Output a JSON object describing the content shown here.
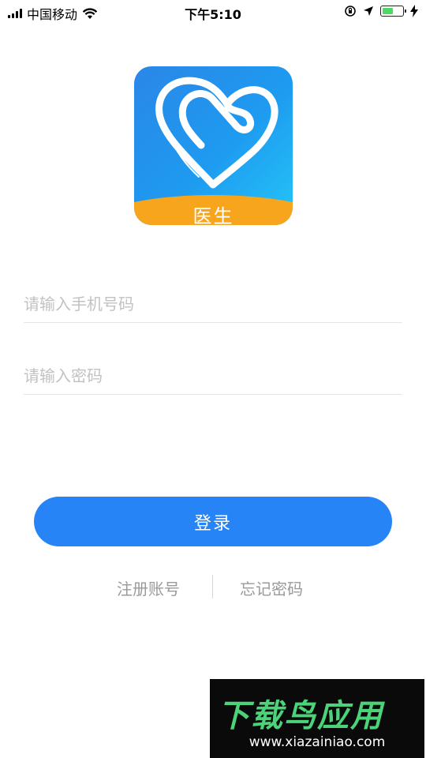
{
  "status_bar": {
    "carrier": "中国移动",
    "time": "下午5:10",
    "battery_level": 0.55,
    "battery_color": "#4cd964"
  },
  "logo": {
    "label": "医生",
    "gradient_colors": [
      "#2a86e8",
      "#24c6f7"
    ],
    "band_color": "#f7a51c",
    "icon": "heart-line-icon"
  },
  "form": {
    "phone_placeholder": "请输入手机号码",
    "phone_value": "",
    "password_placeholder": "请输入密码",
    "password_value": ""
  },
  "login_button": {
    "label": "登录",
    "color": "#2684f6"
  },
  "links": {
    "register": "注册账号",
    "forgot_password": "忘记密码"
  },
  "watermark": {
    "title": "下载鸟应用",
    "url": "www.xiazainiao.com"
  }
}
